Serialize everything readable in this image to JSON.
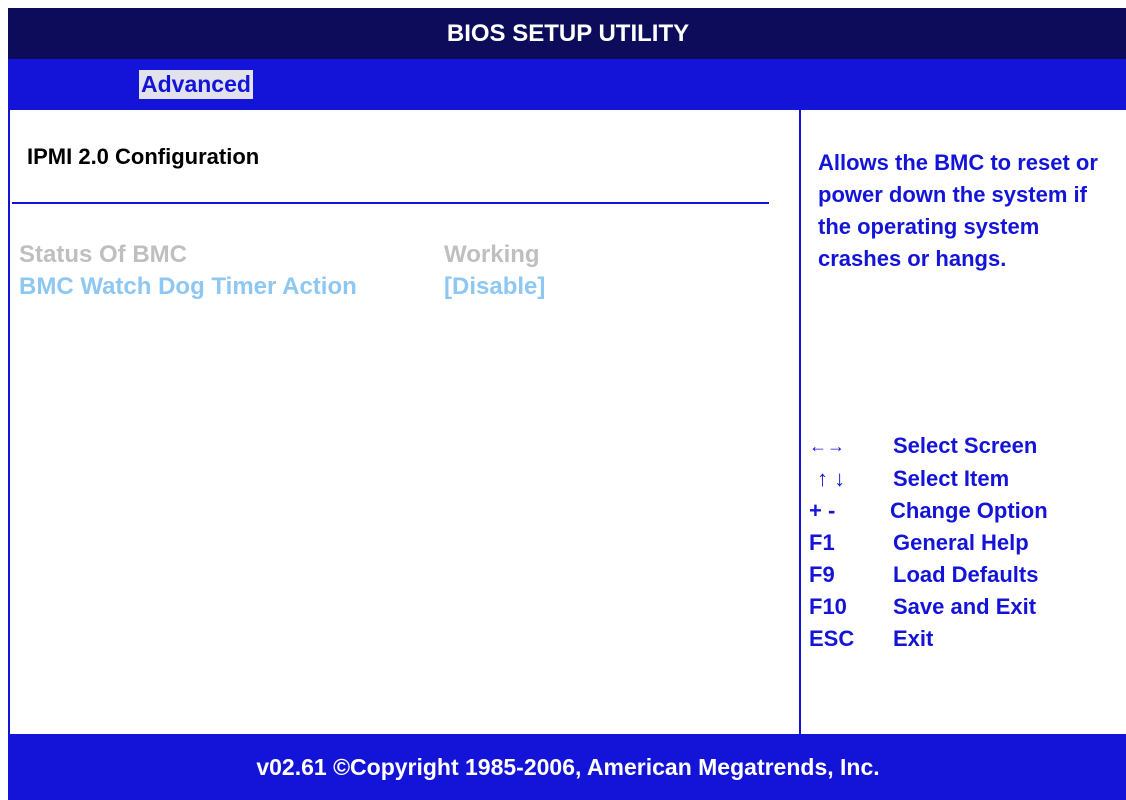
{
  "header": {
    "title": "BIOS SETUP UTILITY"
  },
  "menu": {
    "tabs": [
      {
        "label": "Advanced",
        "selected": true
      }
    ]
  },
  "main": {
    "section_title": "IPMI 2.0 Configuration",
    "items": [
      {
        "label": "Status Of BMC",
        "value": "Working"
      },
      {
        "label": "BMC Watch Dog Timer Action",
        "value": "[Disable]"
      }
    ]
  },
  "help": {
    "text": "Allows the BMC to reset or power down the system if the operating system crashes or hangs."
  },
  "keys": [
    {
      "key": "←→",
      "action": "Select Screen"
    },
    {
      "key": "↑ ↓",
      "action": "Select Item"
    },
    {
      "key": "+ -",
      "action": "Change Option"
    },
    {
      "key": "F1",
      "action": "General Help"
    },
    {
      "key": "F9",
      "action": "Load Defaults"
    },
    {
      "key": "F10",
      "action": "Save and Exit"
    },
    {
      "key": "ESC",
      "action": "Exit"
    }
  ],
  "footer": {
    "text": "v02.61 ©Copyright 1985-2006, American Megatrends, Inc."
  },
  "colors": {
    "title_bg": "#0c0c5a",
    "accent_blue": "#1414d8",
    "disabled_text": "#bfbfbf",
    "highlight_text": "#8ec7f2"
  }
}
